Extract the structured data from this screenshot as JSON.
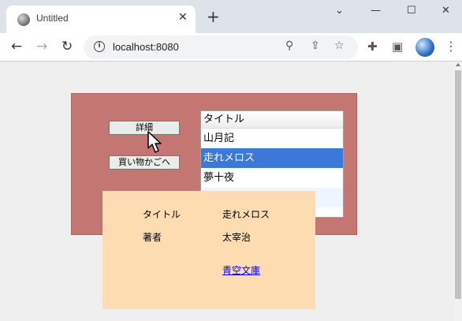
{
  "browser": {
    "tab_title": "Untitled",
    "tab_close": "✕",
    "new_tab": "+",
    "window_controls": {
      "minimize": "⌄",
      "restore": "—",
      "maximize": "☐",
      "close": "✕"
    },
    "url": "localhost:8080",
    "icons": [
      "back-arrow-icon",
      "forward-arrow-icon",
      "reload-icon",
      "info-icon",
      "zoom-icon",
      "share-icon",
      "star-icon",
      "extensions-icon",
      "sidepanel-icon",
      "profile-icon",
      "menu-icon"
    ]
  },
  "page": {
    "detail_button": "詳細",
    "cart_button": "買い物かごへ",
    "list": {
      "header": "タイトル",
      "items": [
        "山月記",
        "走れメロス",
        "夢十夜",
        ""
      ],
      "selected_index": 1
    },
    "detail": {
      "title_label": "タイトル",
      "title_value": "走れメロス",
      "author_label": "著者",
      "author_value": "太宰治",
      "link": "青空文庫"
    }
  },
  "colors": {
    "panel": "#c47672",
    "detail_bg": "#fddcb2",
    "selection": "#3c78d8"
  }
}
